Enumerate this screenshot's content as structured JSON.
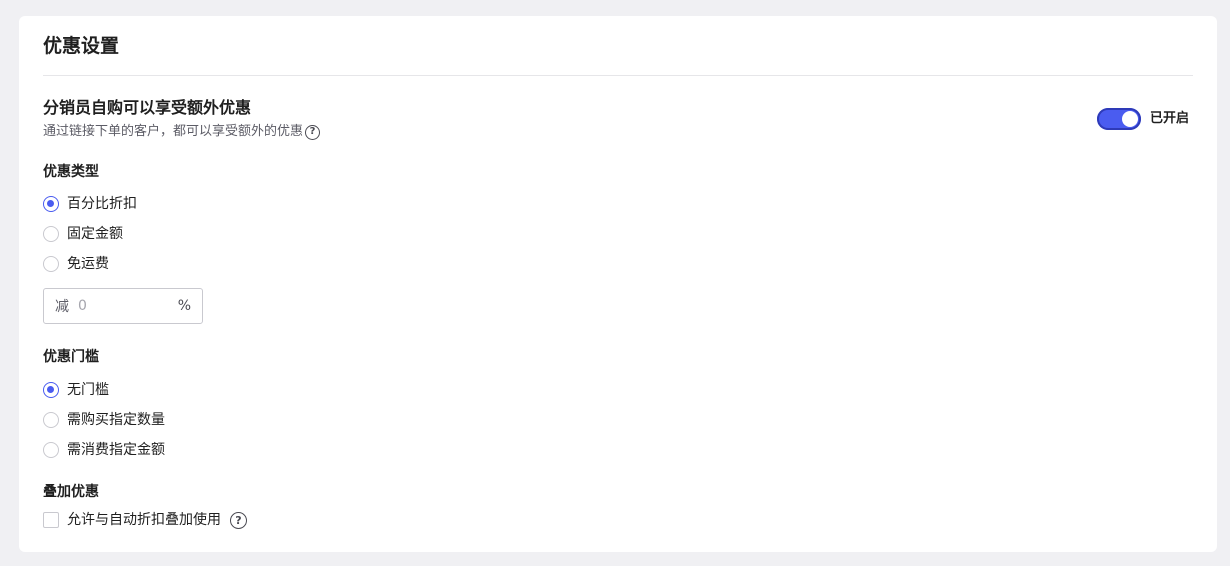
{
  "card": {
    "title": "优惠设置"
  },
  "self_purchase": {
    "title": "分销员自购可以享受额外优惠",
    "description": "通过链接下单的客户，都可以享受额外的优惠",
    "help_glyph": "?",
    "toggle_on": true,
    "toggle_label": "已开启"
  },
  "discount_type": {
    "label": "优惠类型",
    "options": [
      {
        "label": "百分比折扣",
        "checked": true
      },
      {
        "label": "固定金额",
        "checked": false
      },
      {
        "label": "免运费",
        "checked": false
      }
    ],
    "input": {
      "prefix": "减",
      "placeholder": "0",
      "suffix": "%"
    }
  },
  "threshold": {
    "label": "优惠门槛",
    "options": [
      {
        "label": "无门槛",
        "checked": true
      },
      {
        "label": "需购买指定数量",
        "checked": false
      },
      {
        "label": "需消费指定金额",
        "checked": false
      }
    ]
  },
  "stacking": {
    "label": "叠加优惠",
    "checkbox_label": "允许与自动折扣叠加使用",
    "checked": false,
    "help_glyph": "?"
  },
  "colors": {
    "accent": "#4a5cf0",
    "background": "#f0f0f3",
    "card": "#ffffff"
  },
  "icons": {
    "help": "question-circle-icon",
    "radio": "radio-circle",
    "checkbox": "checkbox-square"
  }
}
